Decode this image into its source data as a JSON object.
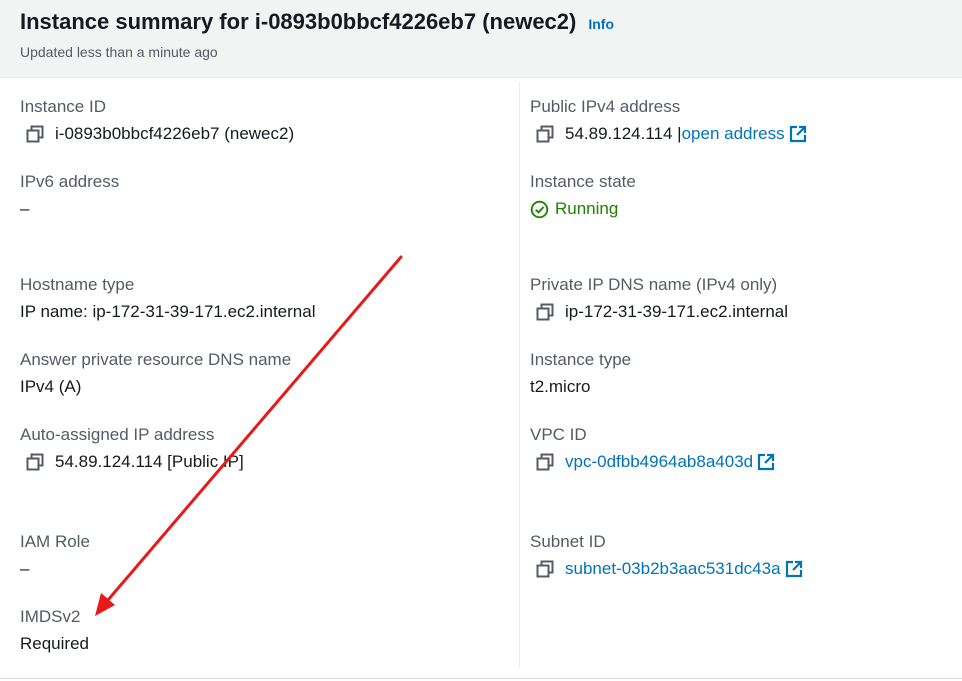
{
  "header": {
    "title": "Instance summary for i-0893b0bbcf4226eb7 (newec2)",
    "info": "Info",
    "updated": "Updated less than a minute ago"
  },
  "left": {
    "instance_id": {
      "label": "Instance ID",
      "value": "i-0893b0bbcf4226eb7 (newec2)"
    },
    "ipv6": {
      "label": "IPv6 address",
      "value": "–"
    },
    "hostname_type": {
      "label": "Hostname type",
      "value": "IP name: ip-172-31-39-171.ec2.internal"
    },
    "answer_dns": {
      "label": "Answer private resource DNS name",
      "value": "IPv4 (A)"
    },
    "auto_ip": {
      "label": "Auto-assigned IP address",
      "value": "54.89.124.114 [Public IP]"
    },
    "iam_role": {
      "label": "IAM Role",
      "value": "–"
    },
    "imdsv2": {
      "label": "IMDSv2",
      "value": "Required"
    }
  },
  "right": {
    "public_ipv4": {
      "label": "Public IPv4 address",
      "value": "54.89.124.114 |",
      "link": "open address"
    },
    "state": {
      "label": "Instance state",
      "value": "Running"
    },
    "private_dns": {
      "label": "Private IP DNS name (IPv4 only)",
      "value": "ip-172-31-39-171.ec2.internal"
    },
    "instance_type": {
      "label": "Instance type",
      "value": "t2.micro"
    },
    "vpc_id": {
      "label": "VPC ID",
      "value": "vpc-0dfbb4964ab8a403d"
    },
    "subnet_id": {
      "label": "Subnet ID",
      "value": "subnet-03b2b3aac531dc43a"
    }
  },
  "colors": {
    "link": "#0073bb",
    "running": "#1d8102",
    "annotation_arrow": "#e8191b"
  },
  "icons": [
    "copy-icon",
    "external-link-icon",
    "check-circle-icon"
  ]
}
